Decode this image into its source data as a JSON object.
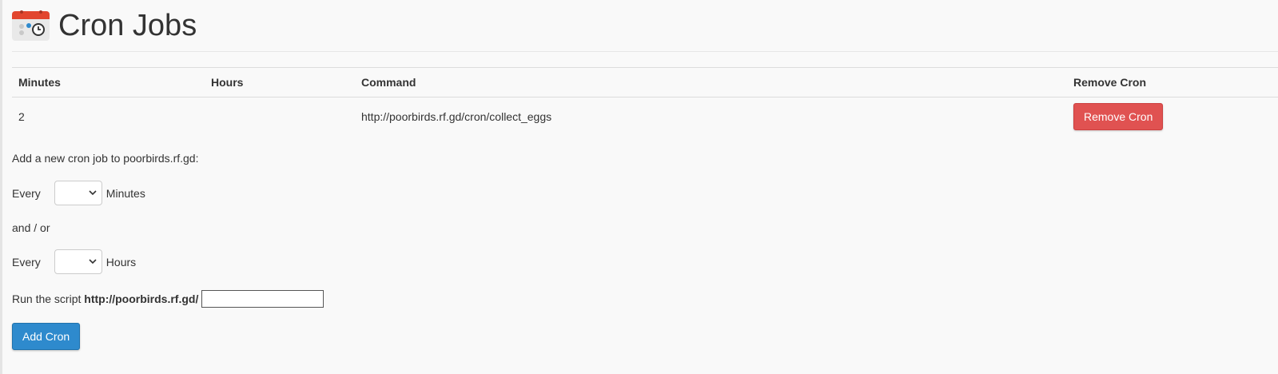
{
  "header": {
    "title": "Cron Jobs"
  },
  "table": {
    "columns": [
      "Minutes",
      "Hours",
      "Command",
      "Remove Cron"
    ],
    "rows": [
      {
        "minutes": "2",
        "hours": "",
        "command": "http://poorbirds.rf.gd/cron/collect_eggs",
        "remove_label": "Remove Cron"
      }
    ]
  },
  "form": {
    "intro": "Add a new cron job to poorbirds.rf.gd:",
    "every_label": "Every",
    "minutes_label": "Minutes",
    "minutes_value": "",
    "and_or": "and / or",
    "hours_label": "Hours",
    "hours_value": "",
    "run_prefix": "Run the script",
    "script_base": "http://poorbirds.rf.gd/",
    "script_value": "",
    "submit_label": "Add Cron"
  },
  "colors": {
    "danger": "#e05251",
    "primary": "#2e8acd",
    "icon_red": "#e2462f"
  },
  "icons": [
    "cron-calendar-clock-icon",
    "chevron-down-icon"
  ]
}
